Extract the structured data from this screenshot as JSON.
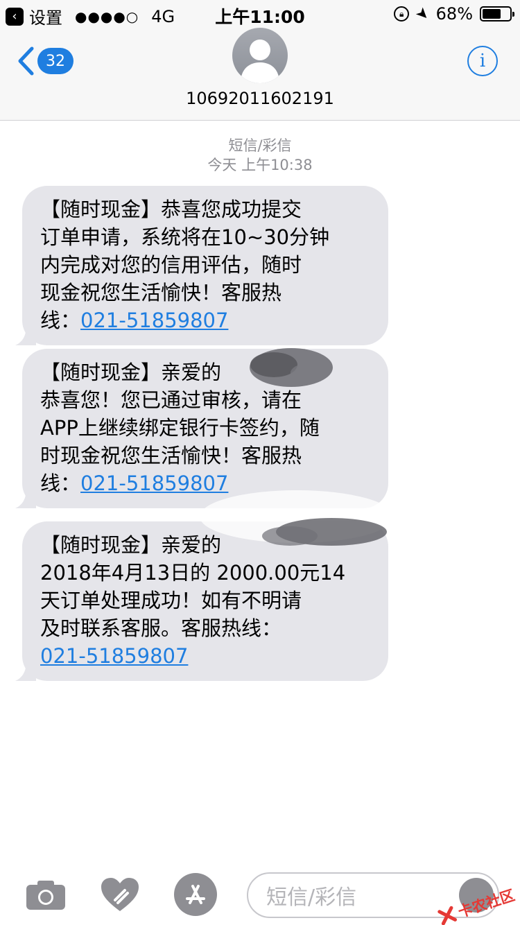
{
  "status_bar": {
    "back_app": "设置",
    "signal_dots": "●●●●○",
    "network": "4G",
    "time": "上午11:00",
    "battery_percent": "68%",
    "battery_level": 0.68
  },
  "nav": {
    "back_count": "32",
    "contact_number": "10692011602191",
    "info_glyph": "i"
  },
  "conversation": {
    "type_label": "短信/彩信",
    "timestamp": "今天 上午10:38"
  },
  "messages": [
    {
      "text_lines": [
        "【随时现金】恭喜您成功提交",
        "订单申请，系统将在10~30分钟",
        "内完成对您的信用评估，随时",
        "现金祝您生活愉快！客服热"
      ],
      "last_prefix": "线：",
      "phone": "021-51859807"
    },
    {
      "text_lines": [
        "【随时现金】亲爱的",
        "恭喜您！您已通过审核，请在",
        "APP上继续绑定银行卡签约，随",
        "时现金祝您生活愉快！客服热"
      ],
      "last_prefix": "线：",
      "phone": "021-51859807"
    },
    {
      "text_lines": [
        "【随时现金】亲爱的",
        "2018年4月13日的 2000.00元14",
        "天订单处理成功！如有不明请",
        "及时联系客服。客服热线："
      ],
      "last_prefix": "",
      "phone": "021-51859807"
    }
  ],
  "input_bar": {
    "placeholder": "短信/彩信",
    "icons": [
      "camera-icon",
      "digital-touch-heart-icon",
      "app-store-icon",
      "microphone-icon"
    ]
  },
  "watermark": {
    "text": "卡农社区"
  },
  "colors": {
    "accent": "#1f7ee0",
    "bubble": "#e5e5ea",
    "bar_bg": "#f7f7f7",
    "secondary_text": "#8e8e93"
  }
}
